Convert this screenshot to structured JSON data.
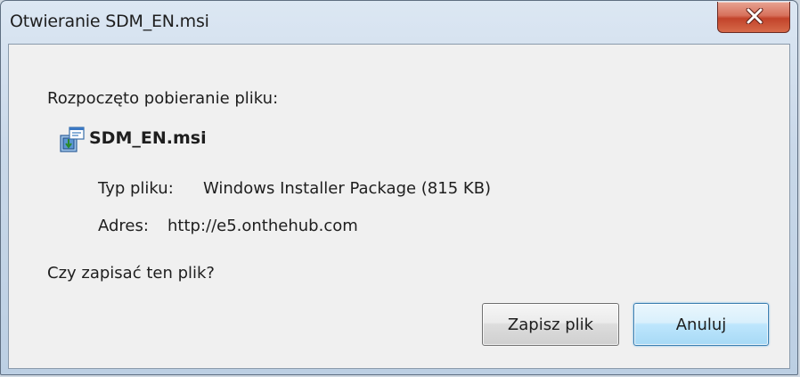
{
  "window": {
    "title": "Otwieranie SDM_EN.msi",
    "close_symbol": "X"
  },
  "dialog": {
    "intro": "Rozpoczęto pobieranie pliku:",
    "file_name": "SDM_EN.msi",
    "file_icon": "windows-installer-package-icon",
    "type_label": "Typ pliku:",
    "type_value": "Windows Installer Package (815 KB)",
    "address_label": "Adres:",
    "address_value": "http://e5.onthehub.com",
    "question": "Czy zapisać ten plik?"
  },
  "buttons": {
    "save_label": "Zapisz plik",
    "cancel_label": "Anuluj"
  },
  "colors": {
    "close_button": "#c8452c",
    "default_button_border": "#3c7fb1",
    "client_background": "#f0f0f0"
  }
}
